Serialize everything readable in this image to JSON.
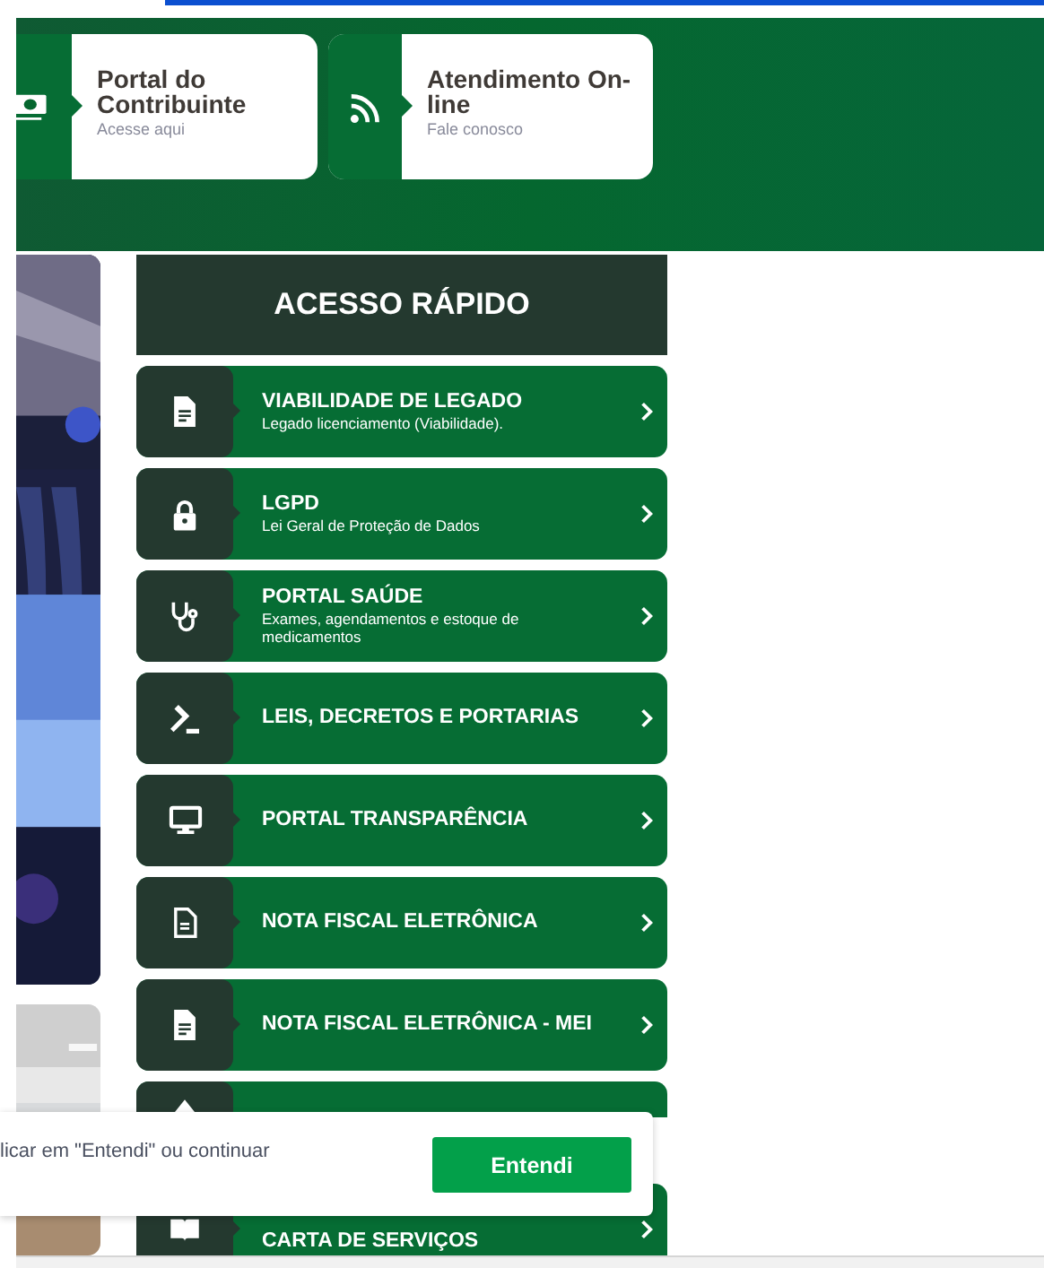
{
  "header_cards": [
    {
      "title": "Portal do Contribuinte",
      "subtitle": "Acesse aqui"
    },
    {
      "title": "Atendimento On-line",
      "subtitle": "Fale conosco"
    }
  ],
  "quick_access": {
    "title": "ACESSO RÁPIDO",
    "items": [
      {
        "label": "VIABILIDADE DE LEGADO",
        "subtitle": "Legado licenciamento (Viabilidade)."
      },
      {
        "label": "LGPD",
        "subtitle": "Lei Geral de Proteção de Dados"
      },
      {
        "label": "PORTAL SAÚDE",
        "subtitle": "Exames, agendamentos e estoque de medicamentos"
      },
      {
        "label": "LEIS, DECRETOS E PORTARIAS"
      },
      {
        "label": "PORTAL TRANSPARÊNCIA"
      },
      {
        "label": "NOTA FISCAL ELETRÔNICA"
      },
      {
        "label": "NOTA FISCAL ELETRÔNICA - MEI"
      },
      {
        "covered": true
      },
      {
        "label": "CARTA DE SERVIÇOS"
      }
    ]
  },
  "cookie_banner": {
    "text": "licar em \"Entendi\" ou continuar",
    "button": "Entendi"
  }
}
